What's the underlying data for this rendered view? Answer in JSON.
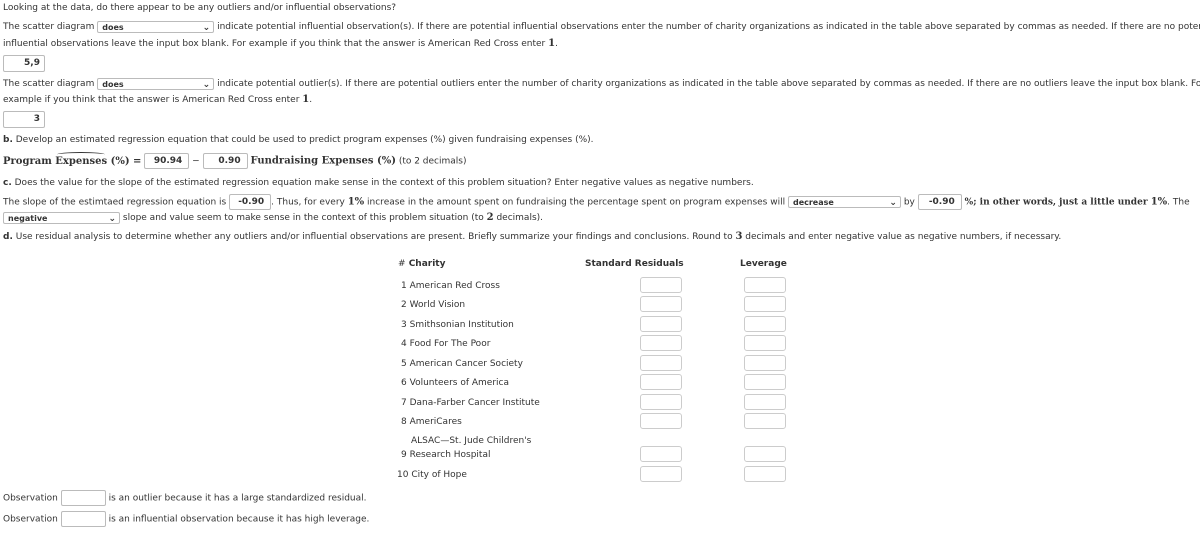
{
  "intro": "Looking at the data, do there appear to be any outliers and/or influential observations?",
  "q1": {
    "prefix": "The scatter diagram",
    "select": "does",
    "text1": "indicate potential influential observation(s). If there are potential influential observations enter the number of charity organizations as indicated in the table above separated by commas as needed. If there are no potential",
    "text2": "influential observations leave the input box blank. For example if you think that the answer is American Red Cross enter ",
    "example": "1",
    "suffix": ".",
    "answer": "5,9"
  },
  "q2": {
    "prefix": "The scatter diagram",
    "select": "does",
    "text1": "indicate potential outlier(s). If there are potential outliers enter the number of charity organizations as indicated in the table above separated by commas as needed. If there are no outliers leave the input box blank. For",
    "text2": "example if you think that the answer is American Red Cross enter ",
    "example": "1",
    "suffix": ".",
    "answer": "3"
  },
  "b": {
    "label": "b.",
    "text": " Develop an estimated regression equation that could be used to predict program expenses (%) given fundraising expenses (%).",
    "lhs_a": "Program ",
    "lhs_b": "Expenses",
    "lhs_c": " (%) =",
    "intercept": "90.94",
    "minus": "−",
    "slope": "0.90",
    "rhs": "Fundraising Expenses (%)",
    "note": "(to 2 decimals)"
  },
  "c": {
    "label": "c.",
    "text": " Does the value for the slope of the estimated regression equation make sense in the context of this problem situation? Enter negative values as negative numbers.",
    "s1": "The slope of the estimtaed regression equation is",
    "slope": "-0.90",
    "s2": ". Thus, for every ",
    "pct": "1%",
    "s3": " increase in the amount spent on fundraising the percentage spent on program expenses will",
    "dir": "decrease",
    "by": "by",
    "amount": "-0.90",
    "s4": "%; in other words, just a little under ",
    "pct2": "1%",
    "s5": ". The",
    "sign": "negative",
    "s6": "slope and value seem to make sense in the context of this problem situation (to ",
    "dec": "2",
    "s7": " decimals)."
  },
  "d": {
    "label": "d.",
    "t1": " Use residual analysis to determine whether any outliers and/or influential observations are present. Briefly summarize your findings and conclusions. Round to ",
    "dec": "3",
    "t2": " decimals and enter negative value as negative numbers, if necessary."
  },
  "table": {
    "headers": {
      "num": "#",
      "charity": "Charity",
      "resid": "Standard Residuals",
      "lev": "Leverage"
    },
    "rows": [
      {
        "n": "1",
        "name": "American Red Cross"
      },
      {
        "n": "2",
        "name": "World Vision"
      },
      {
        "n": "3",
        "name": "Smithsonian Institution"
      },
      {
        "n": "4",
        "name": "Food For The Poor"
      },
      {
        "n": "5",
        "name": "American Cancer Society"
      },
      {
        "n": "6",
        "name": "Volunteers of America"
      },
      {
        "n": "7",
        "name": "Dana-Farber Cancer Institute"
      },
      {
        "n": "8",
        "name": "AmeriCares"
      },
      {
        "n": "9",
        "name_line1": "ALSAC—St. Jude Children's",
        "name": "Research Hospital"
      },
      {
        "n": "10",
        "name": "City of Hope"
      }
    ]
  },
  "obs": [
    {
      "label": "Observation",
      "text": "is an outlier because it has a large standardized residual.",
      "value": ""
    },
    {
      "label": "Observation",
      "text": "is an influential observation because it has high leverage.",
      "value": ""
    }
  ]
}
